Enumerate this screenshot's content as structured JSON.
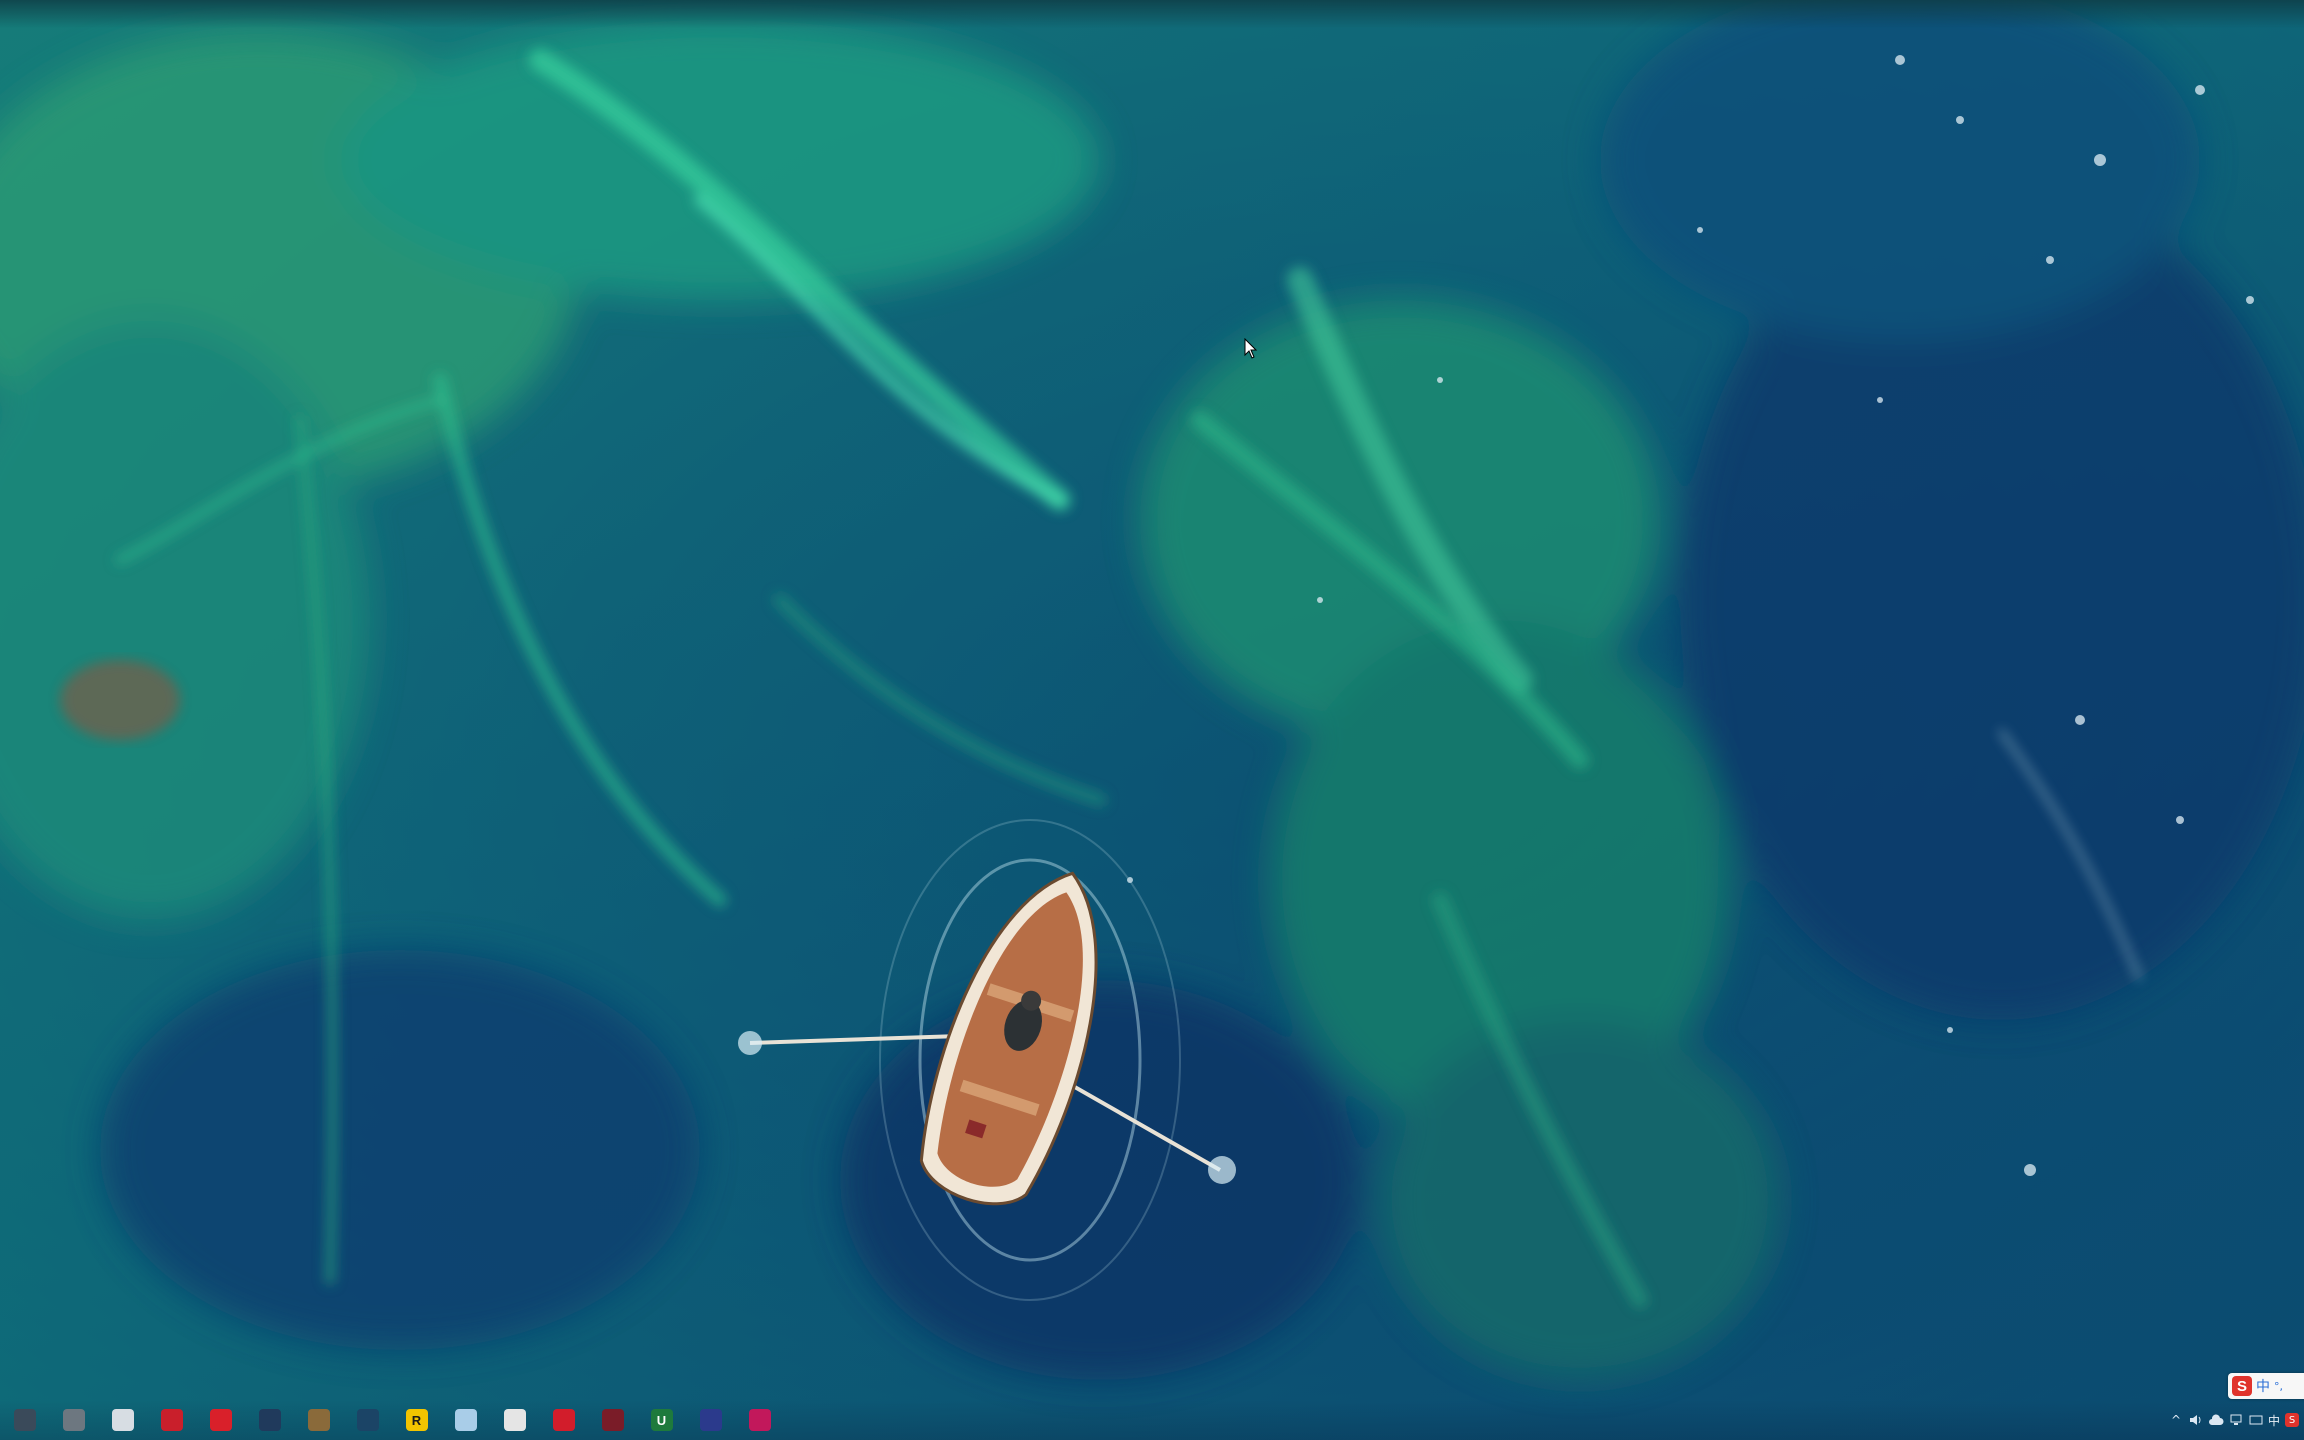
{
  "desktop": {
    "wallpaper": "aerial-ocean-rowboat",
    "colors": {
      "deep": "#0a3d6e",
      "teal": "#0f7a7a",
      "algae": "#2fbf8f",
      "boat": "#c98c5a"
    }
  },
  "taskbar": {
    "pinned": [
      {
        "name": "app-icon-1",
        "glyph": "",
        "bg": "#3a4a5a"
      },
      {
        "name": "app-icon-2",
        "glyph": "",
        "bg": "#6d7780"
      },
      {
        "name": "app-icon-3",
        "glyph": "",
        "bg": "#d7dde3"
      },
      {
        "name": "app-icon-4",
        "glyph": "",
        "bg": "#c91f2b"
      },
      {
        "name": "netease-music-icon",
        "glyph": "",
        "bg": "#d9202a"
      },
      {
        "name": "app-icon-6",
        "glyph": "",
        "bg": "#203a5c"
      },
      {
        "name": "app-icon-7",
        "glyph": "",
        "bg": "#8a6a3a"
      },
      {
        "name": "steam-icon",
        "glyph": "",
        "bg": "#1b4466"
      },
      {
        "name": "app-icon-9",
        "glyph": "R",
        "bg": "#f2c400"
      },
      {
        "name": "app-icon-10",
        "glyph": "",
        "bg": "#a9cde8"
      },
      {
        "name": "chrome-icon",
        "glyph": "",
        "bg": "#e5e5e5"
      },
      {
        "name": "app-icon-12",
        "glyph": "",
        "bg": "#d21d2b"
      },
      {
        "name": "app-icon-13",
        "glyph": "",
        "bg": "#7a1c28"
      },
      {
        "name": "app-icon-14",
        "glyph": "U",
        "bg": "#1e7a3c"
      },
      {
        "name": "app-icon-15",
        "glyph": "",
        "bg": "#2b3a8c"
      },
      {
        "name": "app-icon-16",
        "glyph": "",
        "bg": "#c2185b"
      }
    ],
    "tray": {
      "chevron": "^",
      "volume": "🔊",
      "input_lang": "中",
      "sogou": "S"
    }
  },
  "ime_bar": {
    "logo": "S",
    "mode": "中",
    "punct": "°,"
  }
}
